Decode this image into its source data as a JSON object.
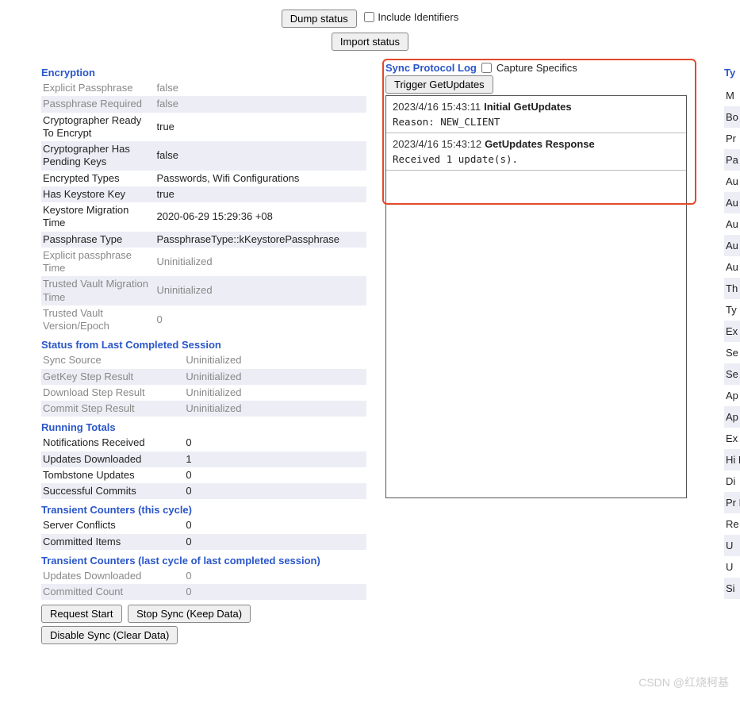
{
  "toolbar": {
    "dump_status_label": "Dump status",
    "include_identifiers_label": "Include Identifiers",
    "import_status_label": "Import status"
  },
  "encryption": {
    "title": "Encryption",
    "rows": [
      {
        "key": "Explicit Passphrase",
        "value": "false",
        "grey": true
      },
      {
        "key": "Passphrase Required",
        "value": "false",
        "grey": true
      },
      {
        "key": "Cryptographer Ready To Encrypt",
        "value": "true",
        "grey": false
      },
      {
        "key": "Cryptographer Has Pending Keys",
        "value": "false",
        "grey": false
      },
      {
        "key": "Encrypted Types",
        "value": "Passwords, Wifi Configurations",
        "grey": false
      },
      {
        "key": "Has Keystore Key",
        "value": "true",
        "grey": false
      },
      {
        "key": "Keystore Migration Time",
        "value": "2020-06-29 15:29:36 +08",
        "grey": false
      },
      {
        "key": "Passphrase Type",
        "value": "PassphraseType::kKeystorePassphrase",
        "grey": false
      },
      {
        "key": "Explicit passphrase Time",
        "value": "Uninitialized",
        "grey": true
      },
      {
        "key": "Trusted Vault Migration Time",
        "value": "Uninitialized",
        "grey": true
      },
      {
        "key": "Trusted Vault Version/Epoch",
        "value": "0",
        "grey": true
      }
    ]
  },
  "last_session": {
    "title": "Status from Last Completed Session",
    "rows": [
      {
        "key": "Sync Source",
        "value": "Uninitialized",
        "grey": true
      },
      {
        "key": "GetKey Step Result",
        "value": "Uninitialized",
        "grey": true
      },
      {
        "key": "Download Step Result",
        "value": "Uninitialized",
        "grey": true
      },
      {
        "key": "Commit Step Result",
        "value": "Uninitialized",
        "grey": true
      }
    ]
  },
  "running_totals": {
    "title": "Running Totals",
    "rows": [
      {
        "key": "Notifications Received",
        "value": "0"
      },
      {
        "key": "Updates Downloaded",
        "value": "1"
      },
      {
        "key": "Tombstone Updates",
        "value": "0"
      },
      {
        "key": "Successful Commits",
        "value": "0"
      }
    ]
  },
  "transient_cycle": {
    "title": "Transient Counters (this cycle)",
    "rows": [
      {
        "key": "Server Conflicts",
        "value": "0"
      },
      {
        "key": "Committed Items",
        "value": "0"
      }
    ]
  },
  "transient_last": {
    "title": "Transient Counters (last cycle of last completed session)",
    "rows": [
      {
        "key": "Updates Downloaded",
        "value": "0",
        "grey": true
      },
      {
        "key": "Committed Count",
        "value": "0",
        "grey": true
      }
    ]
  },
  "action_buttons": {
    "request_start": "Request Start",
    "stop_sync": "Stop Sync (Keep Data)",
    "disable_sync": "Disable Sync (Clear Data)"
  },
  "protocol_log": {
    "title": "Sync Protocol Log",
    "capture_label": "Capture Specifics",
    "trigger_label": "Trigger GetUpdates",
    "entries": [
      {
        "ts": "2023/4/16 15:43:11",
        "title": "Initial GetUpdates",
        "body": "Reason: NEW_CLIENT"
      },
      {
        "ts": "2023/4/16 15:43:12",
        "title": "GetUpdates Response",
        "body": "Received 1 update(s)."
      }
    ]
  },
  "right_panel": {
    "title": "Ty",
    "items": [
      "M",
      "Bo",
      "Pr",
      "Pa",
      "Au",
      "Au",
      "Au",
      "Au M",
      "Au O",
      "Th",
      "Ty",
      "Ex",
      "Se",
      "Se",
      "Ap",
      "Ap",
      "Ex se",
      "Hi Di",
      "Di",
      "Pr Pr",
      "Re",
      "U",
      "U",
      "Si"
    ]
  },
  "watermark": "CSDN @红烧柯基"
}
